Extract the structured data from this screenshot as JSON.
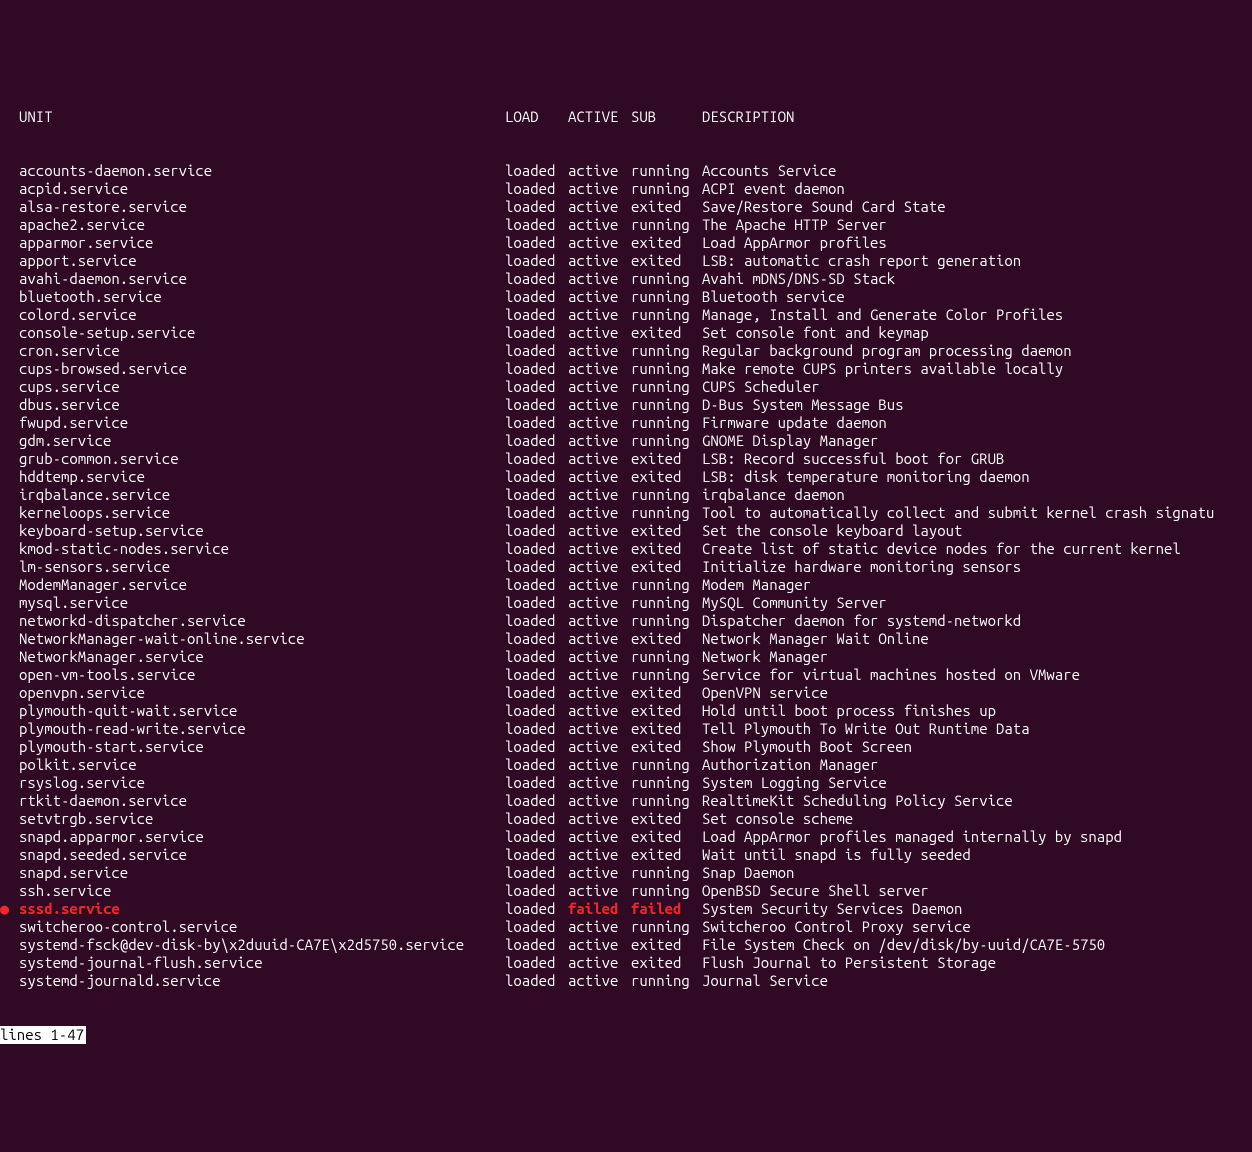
{
  "header": {
    "indent": "  ",
    "unit": "UNIT",
    "load": "LOAD",
    "active": "ACTIVE",
    "sub": "SUB",
    "description": "DESCRIPTION"
  },
  "services": [
    {
      "unit": "accounts-daemon.service",
      "load": "loaded",
      "active": "active",
      "sub": "running",
      "desc": "Accounts Service"
    },
    {
      "unit": "acpid.service",
      "load": "loaded",
      "active": "active",
      "sub": "running",
      "desc": "ACPI event daemon"
    },
    {
      "unit": "alsa-restore.service",
      "load": "loaded",
      "active": "active",
      "sub": "exited",
      "desc": "Save/Restore Sound Card State"
    },
    {
      "unit": "apache2.service",
      "load": "loaded",
      "active": "active",
      "sub": "running",
      "desc": "The Apache HTTP Server"
    },
    {
      "unit": "apparmor.service",
      "load": "loaded",
      "active": "active",
      "sub": "exited",
      "desc": "Load AppArmor profiles"
    },
    {
      "unit": "apport.service",
      "load": "loaded",
      "active": "active",
      "sub": "exited",
      "desc": "LSB: automatic crash report generation"
    },
    {
      "unit": "avahi-daemon.service",
      "load": "loaded",
      "active": "active",
      "sub": "running",
      "desc": "Avahi mDNS/DNS-SD Stack"
    },
    {
      "unit": "bluetooth.service",
      "load": "loaded",
      "active": "active",
      "sub": "running",
      "desc": "Bluetooth service"
    },
    {
      "unit": "colord.service",
      "load": "loaded",
      "active": "active",
      "sub": "running",
      "desc": "Manage, Install and Generate Color Profiles"
    },
    {
      "unit": "console-setup.service",
      "load": "loaded",
      "active": "active",
      "sub": "exited",
      "desc": "Set console font and keymap"
    },
    {
      "unit": "cron.service",
      "load": "loaded",
      "active": "active",
      "sub": "running",
      "desc": "Regular background program processing daemon"
    },
    {
      "unit": "cups-browsed.service",
      "load": "loaded",
      "active": "active",
      "sub": "running",
      "desc": "Make remote CUPS printers available locally"
    },
    {
      "unit": "cups.service",
      "load": "loaded",
      "active": "active",
      "sub": "running",
      "desc": "CUPS Scheduler"
    },
    {
      "unit": "dbus.service",
      "load": "loaded",
      "active": "active",
      "sub": "running",
      "desc": "D-Bus System Message Bus"
    },
    {
      "unit": "fwupd.service",
      "load": "loaded",
      "active": "active",
      "sub": "running",
      "desc": "Firmware update daemon"
    },
    {
      "unit": "gdm.service",
      "load": "loaded",
      "active": "active",
      "sub": "running",
      "desc": "GNOME Display Manager"
    },
    {
      "unit": "grub-common.service",
      "load": "loaded",
      "active": "active",
      "sub": "exited",
      "desc": "LSB: Record successful boot for GRUB"
    },
    {
      "unit": "hddtemp.service",
      "load": "loaded",
      "active": "active",
      "sub": "exited",
      "desc": "LSB: disk temperature monitoring daemon"
    },
    {
      "unit": "irqbalance.service",
      "load": "loaded",
      "active": "active",
      "sub": "running",
      "desc": "irqbalance daemon"
    },
    {
      "unit": "kerneloops.service",
      "load": "loaded",
      "active": "active",
      "sub": "running",
      "desc": "Tool to automatically collect and submit kernel crash signatu"
    },
    {
      "unit": "keyboard-setup.service",
      "load": "loaded",
      "active": "active",
      "sub": "exited",
      "desc": "Set the console keyboard layout"
    },
    {
      "unit": "kmod-static-nodes.service",
      "load": "loaded",
      "active": "active",
      "sub": "exited",
      "desc": "Create list of static device nodes for the current kernel"
    },
    {
      "unit": "lm-sensors.service",
      "load": "loaded",
      "active": "active",
      "sub": "exited",
      "desc": "Initialize hardware monitoring sensors"
    },
    {
      "unit": "ModemManager.service",
      "load": "loaded",
      "active": "active",
      "sub": "running",
      "desc": "Modem Manager"
    },
    {
      "unit": "mysql.service",
      "load": "loaded",
      "active": "active",
      "sub": "running",
      "desc": "MySQL Community Server"
    },
    {
      "unit": "networkd-dispatcher.service",
      "load": "loaded",
      "active": "active",
      "sub": "running",
      "desc": "Dispatcher daemon for systemd-networkd"
    },
    {
      "unit": "NetworkManager-wait-online.service",
      "load": "loaded",
      "active": "active",
      "sub": "exited",
      "desc": "Network Manager Wait Online"
    },
    {
      "unit": "NetworkManager.service",
      "load": "loaded",
      "active": "active",
      "sub": "running",
      "desc": "Network Manager"
    },
    {
      "unit": "open-vm-tools.service",
      "load": "loaded",
      "active": "active",
      "sub": "running",
      "desc": "Service for virtual machines hosted on VMware"
    },
    {
      "unit": "openvpn.service",
      "load": "loaded",
      "active": "active",
      "sub": "exited",
      "desc": "OpenVPN service"
    },
    {
      "unit": "plymouth-quit-wait.service",
      "load": "loaded",
      "active": "active",
      "sub": "exited",
      "desc": "Hold until boot process finishes up"
    },
    {
      "unit": "plymouth-read-write.service",
      "load": "loaded",
      "active": "active",
      "sub": "exited",
      "desc": "Tell Plymouth To Write Out Runtime Data"
    },
    {
      "unit": "plymouth-start.service",
      "load": "loaded",
      "active": "active",
      "sub": "exited",
      "desc": "Show Plymouth Boot Screen"
    },
    {
      "unit": "polkit.service",
      "load": "loaded",
      "active": "active",
      "sub": "running",
      "desc": "Authorization Manager"
    },
    {
      "unit": "rsyslog.service",
      "load": "loaded",
      "active": "active",
      "sub": "running",
      "desc": "System Logging Service"
    },
    {
      "unit": "rtkit-daemon.service",
      "load": "loaded",
      "active": "active",
      "sub": "running",
      "desc": "RealtimeKit Scheduling Policy Service"
    },
    {
      "unit": "setvtrgb.service",
      "load": "loaded",
      "active": "active",
      "sub": "exited",
      "desc": "Set console scheme"
    },
    {
      "unit": "snapd.apparmor.service",
      "load": "loaded",
      "active": "active",
      "sub": "exited",
      "desc": "Load AppArmor profiles managed internally by snapd"
    },
    {
      "unit": "snapd.seeded.service",
      "load": "loaded",
      "active": "active",
      "sub": "exited",
      "desc": "Wait until snapd is fully seeded"
    },
    {
      "unit": "snapd.service",
      "load": "loaded",
      "active": "active",
      "sub": "running",
      "desc": "Snap Daemon"
    },
    {
      "unit": "ssh.service",
      "load": "loaded",
      "active": "active",
      "sub": "running",
      "desc": "OpenBSD Secure Shell server"
    },
    {
      "unit": "sssd.service",
      "load": "loaded",
      "active": "failed",
      "sub": "failed",
      "desc": "System Security Services Daemon",
      "failed": true
    },
    {
      "unit": "switcheroo-control.service",
      "load": "loaded",
      "active": "active",
      "sub": "running",
      "desc": "Switcheroo Control Proxy service"
    },
    {
      "unit": "systemd-fsck@dev-disk-by\\x2duuid-CA7E\\x2d5750.service",
      "load": "loaded",
      "active": "active",
      "sub": "exited",
      "desc": "File System Check on /dev/disk/by-uuid/CA7E-5750"
    },
    {
      "unit": "systemd-journal-flush.service",
      "load": "loaded",
      "active": "active",
      "sub": "exited",
      "desc": "Flush Journal to Persistent Storage"
    },
    {
      "unit": "systemd-journald.service",
      "load": "loaded",
      "active": "active",
      "sub": "running",
      "desc": "Journal Service"
    }
  ],
  "status": "lines 1-47",
  "bullet_char": "●"
}
